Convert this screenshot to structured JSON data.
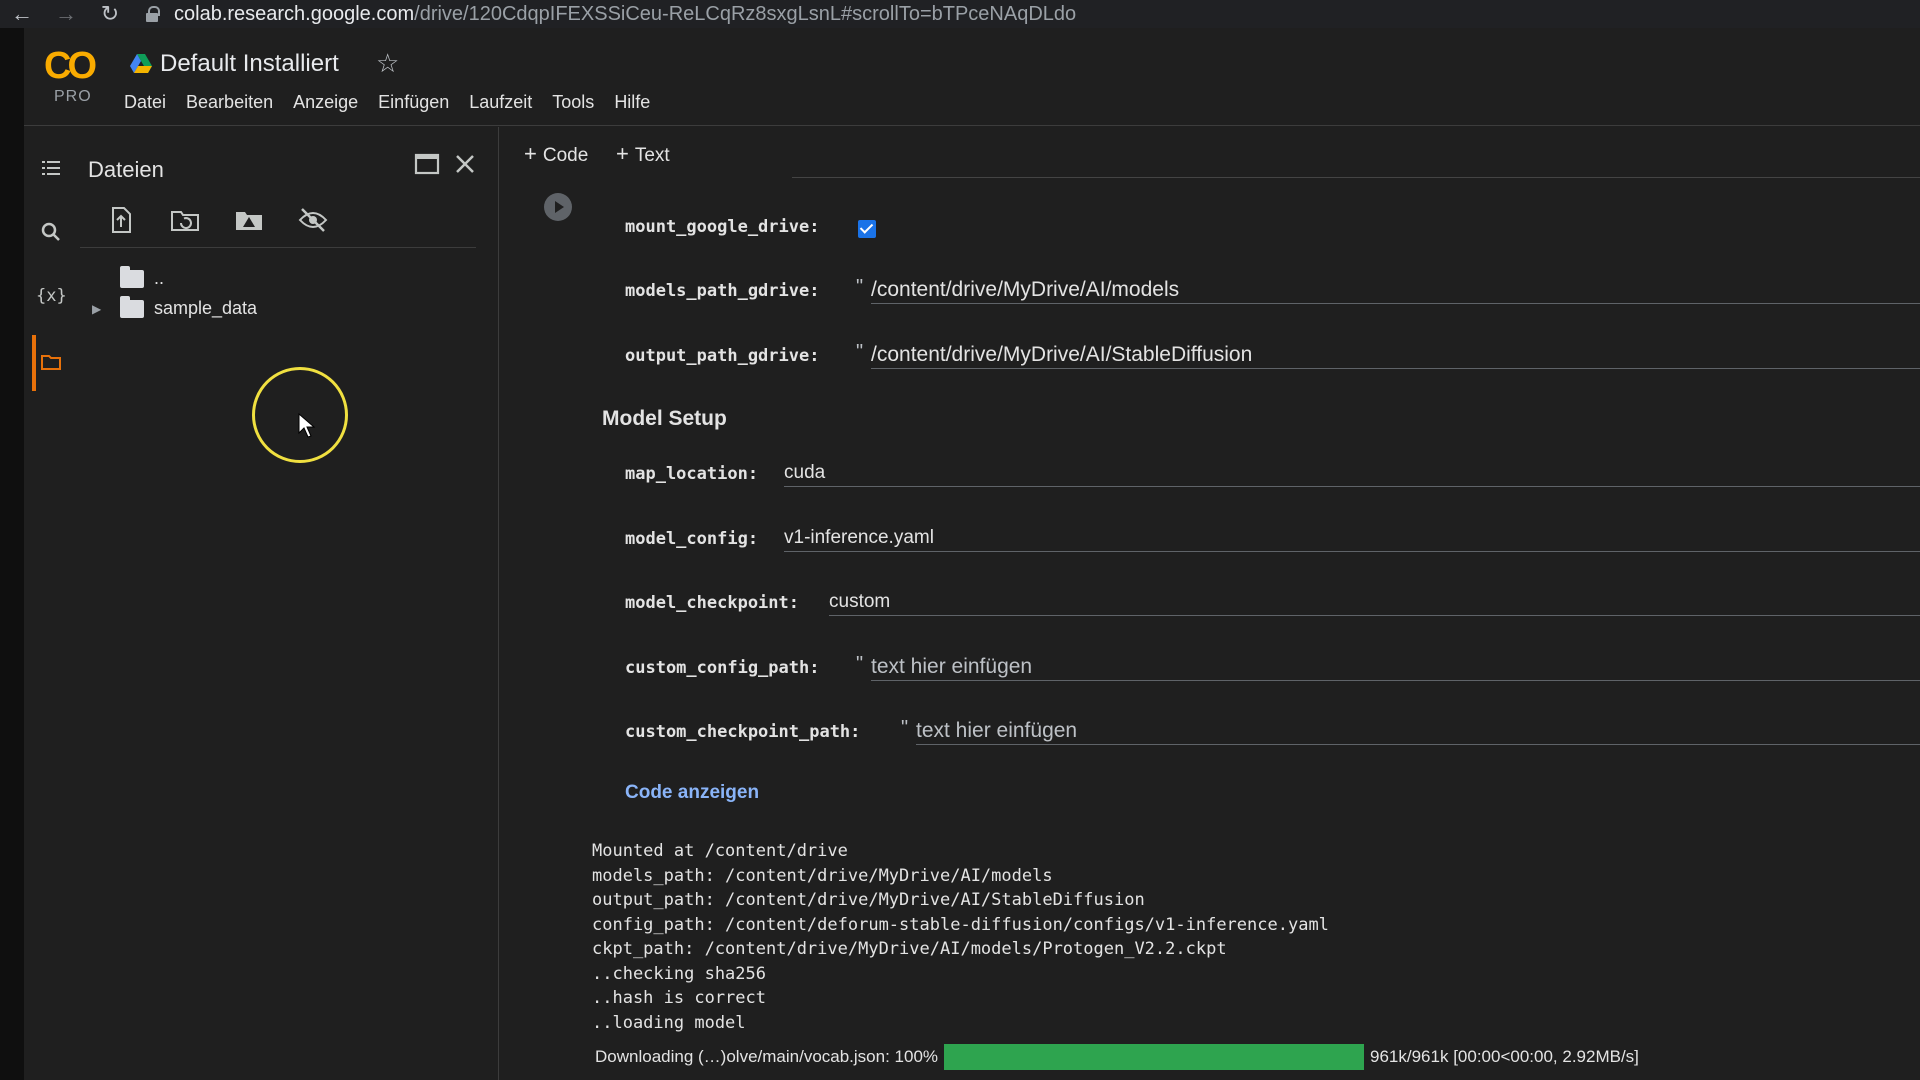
{
  "browser": {
    "url_host": "colab.research.google.com",
    "url_rest": "/drive/120CdqpIFEXSSiCeu-ReLCqRz8sxgLsnL#scrollTo=bTPceNAqDLdo"
  },
  "header": {
    "logo_text": "CO",
    "logo_badge": "PRO",
    "title": "Default Installiert",
    "menu": [
      "Datei",
      "Bearbeiten",
      "Anzeige",
      "Einfügen",
      "Laufzeit",
      "Tools",
      "Hilfe"
    ]
  },
  "sidebar": {
    "panel_title": "Dateien",
    "variables_label": "{x}",
    "tree": [
      {
        "name": ".."
      },
      {
        "name": "sample_data"
      }
    ]
  },
  "toolbar": {
    "add_code": "Code",
    "add_text": "Text"
  },
  "form": {
    "mount_google_drive": {
      "label": "mount_google_drive:",
      "checked": true
    },
    "models_path_gdrive": {
      "label": "models_path_gdrive:",
      "value": "/content/drive/MyDrive/AI/models"
    },
    "output_path_gdrive": {
      "label": "output_path_gdrive:",
      "value": "/content/drive/MyDrive/AI/StableDiffusion"
    },
    "section_model_setup": "Model Setup",
    "map_location": {
      "label": "map_location:",
      "value": "cuda"
    },
    "model_config": {
      "label": "model_config:",
      "value": "v1-inference.yaml"
    },
    "model_checkpoint": {
      "label": "model_checkpoint:",
      "value": "custom"
    },
    "custom_config_path": {
      "label": "custom_config_path:",
      "placeholder": "text hier einfügen"
    },
    "custom_checkpoint_path": {
      "label": "custom_checkpoint_path:",
      "placeholder": "text hier einfügen"
    },
    "show_code": "Code anzeigen"
  },
  "output": {
    "lines": [
      "Mounted at /content/drive",
      "models_path: /content/drive/MyDrive/AI/models",
      "output_path: /content/drive/MyDrive/AI/StableDiffusion",
      "config_path: /content/deforum-stable-diffusion/configs/v1-inference.yaml",
      "ckpt_path: /content/drive/MyDrive/AI/models/Protogen_V2.2.ckpt",
      "..checking sha256",
      "..hash is correct",
      "..loading model"
    ],
    "progress": {
      "label": "Downloading (…)olve/main/vocab.json: 100%",
      "fraction": 1.0,
      "stats": "961k/961k [00:00<00:00, 2.92MB/s]"
    }
  },
  "colors": {
    "accent_orange": "#e8710a",
    "logo_yellow": "#f9ab00",
    "link_blue": "#8ab4f8",
    "checkbox_blue": "#1a73e8",
    "progress_green": "#2ea44f"
  }
}
